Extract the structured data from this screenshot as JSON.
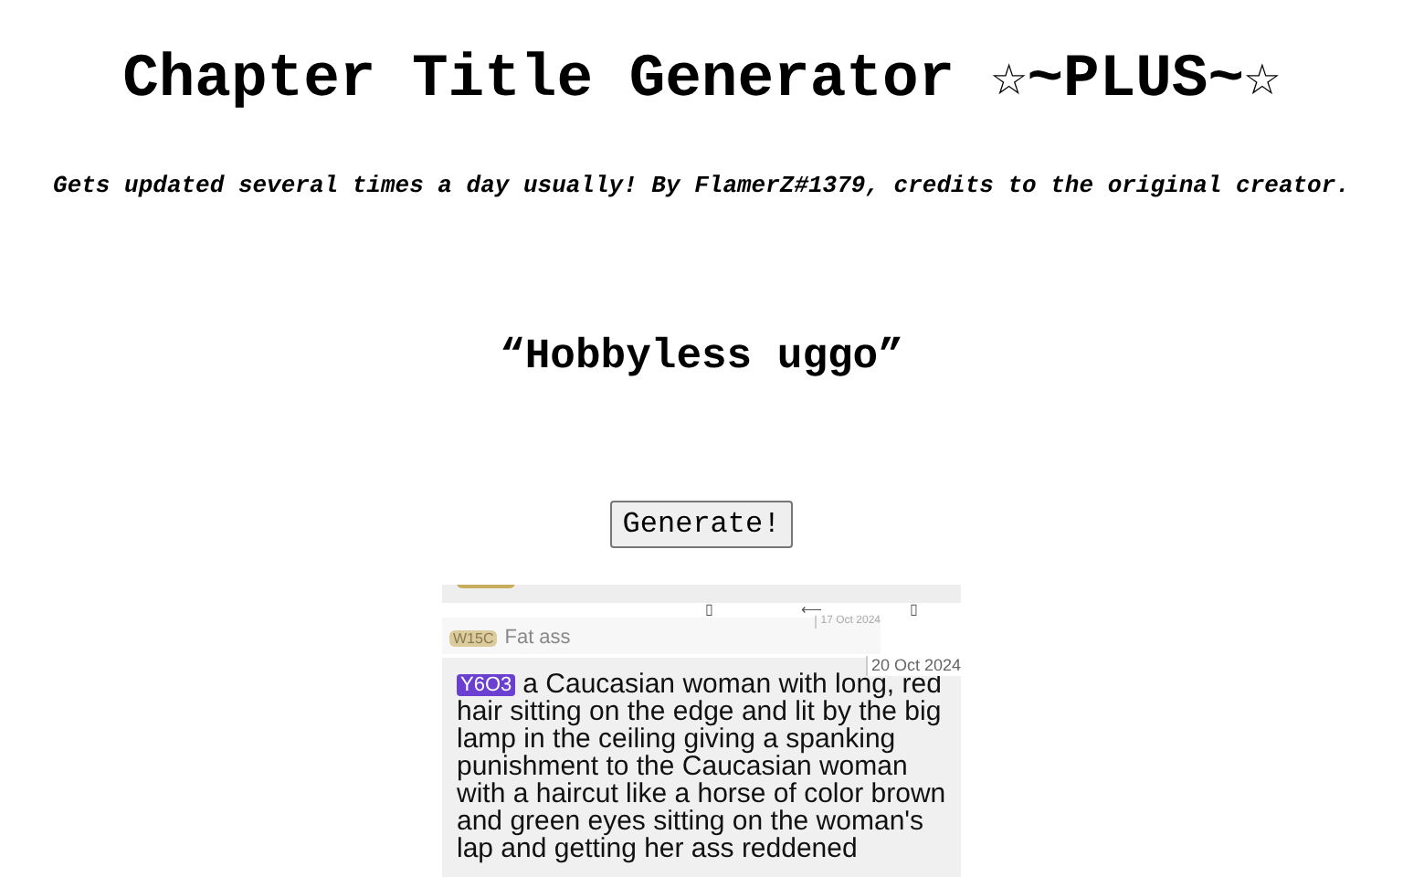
{
  "title": "Chapter Title Generator ☆~PLUS~☆",
  "subtitle": "Gets updated several times a day usually! By FlamerZ#1379, credits to the original creator.",
  "result": "“Hobbyless uggo”",
  "button": "Generate!",
  "screenshot": {
    "toolbar": [
      "▯",
      "⟵",
      "▯"
    ],
    "messages": [
      {
        "kind": "faded",
        "code": "W15C",
        "color": "#dccb9c",
        "text": "Fat ass",
        "date": "17 Oct 2024"
      },
      {
        "kind": "full",
        "code": "Y6O3",
        "color": "#6b3fcf",
        "text": "a Caucasian woman with long, red hair sitting on the edge and lit by the big lamp in the ceiling giving a spanking punishment to the Caucasian woman with a haircut like a horse of color brown and green eyes sitting on the woman's lap and getting her ass reddened",
        "date": "20 Oct 2024"
      }
    ]
  }
}
